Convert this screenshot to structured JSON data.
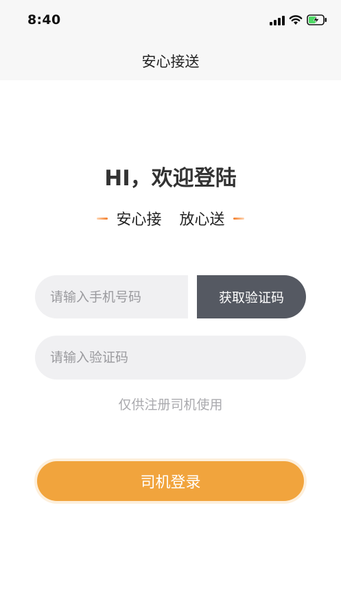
{
  "status_bar": {
    "time": "8:40",
    "icons": [
      "cellular-signal-icon",
      "wifi-icon",
      "battery-charging-icon"
    ],
    "battery_color": "#4cd964"
  },
  "nav": {
    "title": "安心接送"
  },
  "welcome": {
    "heading": "HI，欢迎登陆",
    "slogan_left": "安心接",
    "slogan_right": "放心送"
  },
  "form": {
    "phone_placeholder": "请输入手机号码",
    "phone_value": "",
    "get_code_label": "获取验证码",
    "code_placeholder": "请输入验证码",
    "code_value": "",
    "note": "仅供注册司机使用",
    "login_label": "司机登录"
  },
  "colors": {
    "accent": "#f1a43d",
    "code_button": "#555962",
    "slogan_dash": "#f37e2b"
  }
}
